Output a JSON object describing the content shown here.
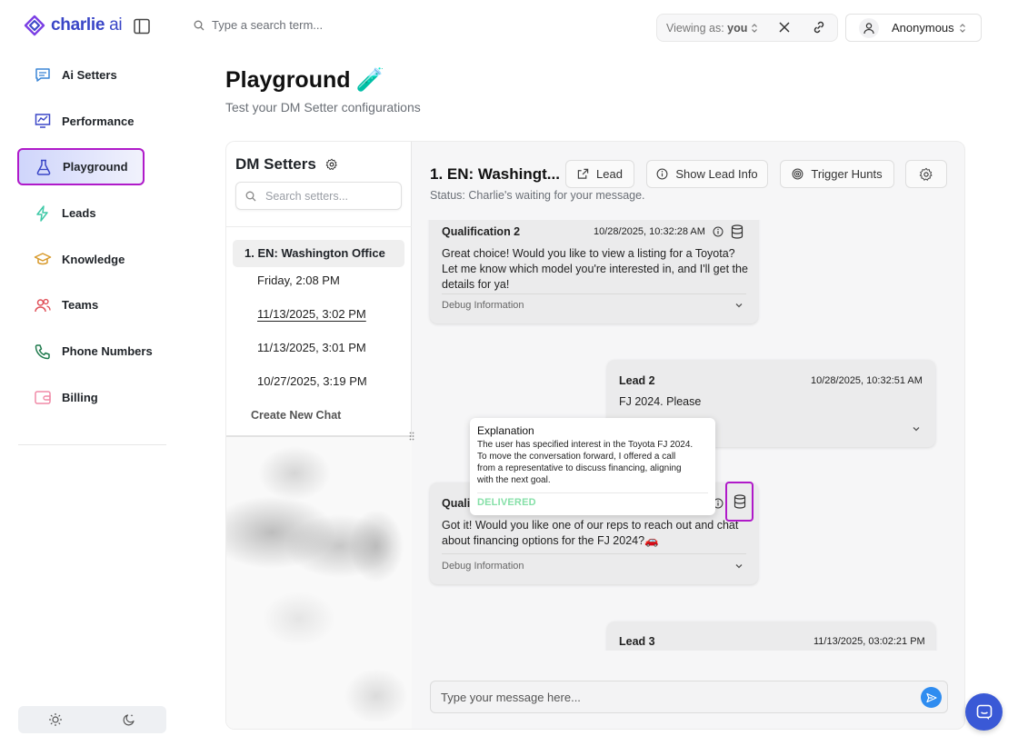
{
  "brand": {
    "name": "charlie",
    "suffix": " ai"
  },
  "search": {
    "placeholder": "Type a search term..."
  },
  "viewing": {
    "prefix": "Viewing as: ",
    "value": "you"
  },
  "account": {
    "name": "Anonymous"
  },
  "sidebar": {
    "items": [
      {
        "label": "Ai Setters",
        "icon": "chat-icon"
      },
      {
        "label": "Performance",
        "icon": "chart-icon"
      },
      {
        "label": "Playground",
        "icon": "flask-icon",
        "active": true
      },
      {
        "label": "Leads",
        "icon": "bolt-icon"
      },
      {
        "label": "Knowledge",
        "icon": "graduation-cap-icon"
      },
      {
        "label": "Teams",
        "icon": "users-icon"
      },
      {
        "label": "Phone Numbers",
        "icon": "phone-icon"
      },
      {
        "label": "Billing",
        "icon": "wallet-icon"
      }
    ]
  },
  "page": {
    "title": "Playground",
    "title_emoji": "🧪",
    "subtitle": "Test your DM Setter configurations"
  },
  "setters": {
    "title": "DM Setters",
    "search_placeholder": "Search setters...",
    "active_setter": "1. EN: Washington Office",
    "chats": [
      "Friday, 2:08 PM",
      "11/13/2025, 3:02 PM",
      "11/13/2025, 3:01 PM",
      "10/27/2025, 3:19 PM"
    ],
    "create_label": "Create New Chat"
  },
  "chat": {
    "title": "1. EN: Washingt...",
    "status": "Status: Charlie's waiting for your message.",
    "buttons": {
      "lead": "Lead",
      "lead_info": "Show Lead Info",
      "trigger": "Trigger Hunts"
    },
    "messages": [
      {
        "author": "Qualification 2",
        "timestamp": "10/28/2025, 10:32:28 AM",
        "lines": [
          "Great choice! Would you like to view a listing for a Toyota?",
          "Let me know which model you're interested in, and I'll get the",
          "details for ya!"
        ],
        "debug": "Debug Information"
      },
      {
        "author": "Lead 2",
        "timestamp": "10/28/2025, 10:32:51 AM",
        "lines": [
          "FJ 2024. Please"
        ]
      },
      {
        "author": "Qualification 3",
        "author_visible": "Quali",
        "lines": [
          "Got it! Would you like one of our reps to reach out and chat",
          "about financing options for the FJ 2024?🚗"
        ],
        "debug": "Debug Information"
      },
      {
        "author": "Lead 3",
        "timestamp": "11/13/2025, 03:02:21 PM"
      }
    ],
    "tooltip": {
      "title": "Explanation",
      "lines": [
        "The user has specified interest in the Toyota FJ 2024.",
        "To move the conversation forward, I offered a call",
        "from a representative to discuss financing, aligning",
        "with the next goal."
      ],
      "status": "DELIVERED"
    },
    "composer_placeholder": "Type your message here..."
  },
  "colors": {
    "accent": "#3a46c7",
    "highlight": "#b01ac9",
    "send": "#2f8cf0",
    "delivered": "#86e0a8"
  }
}
